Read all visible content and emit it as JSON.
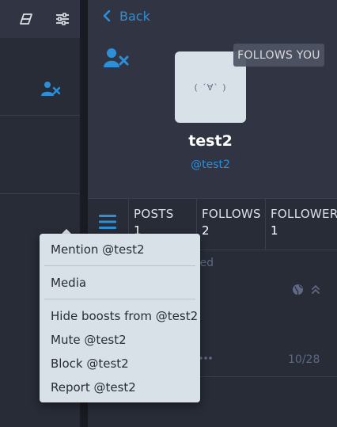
{
  "colors": {
    "accent": "#2b90d9",
    "column_bg": "#282c37",
    "header_bg": "#313543",
    "dropdown_bg": "#d9e1e8",
    "muted": "#606984"
  },
  "left_header": {
    "icons": [
      "eraser-icon",
      "sliders-icon"
    ]
  },
  "left_list": {
    "row_icon": "user-times-icon"
  },
  "back_bar": {
    "label": "Back",
    "icon": "chevron-left-icon"
  },
  "profile": {
    "blocked_icon": "user-times-icon",
    "follows_badge": "FOLLOWS YOU",
    "avatar_text": "( ´∀` )",
    "display_name": "test2",
    "acct": "@test2"
  },
  "counts": [
    {
      "label": "POSTS",
      "value": "1"
    },
    {
      "label": "FOLLOWS",
      "value": "2"
    },
    {
      "label": "FOLLOWER",
      "value": "1"
    }
  ],
  "status": {
    "pinned_text": "ted",
    "date": "10/28",
    "visibility_icon": "globe-icon",
    "boost_icon": "double-chevron-up-icon",
    "more_icon": "ellipsis-icon"
  },
  "dropdown": {
    "items": [
      "Mention @test2",
      "Media",
      "Hide boosts from @test2",
      "Mute @test2",
      "Block @test2",
      "Report @test2"
    ]
  }
}
